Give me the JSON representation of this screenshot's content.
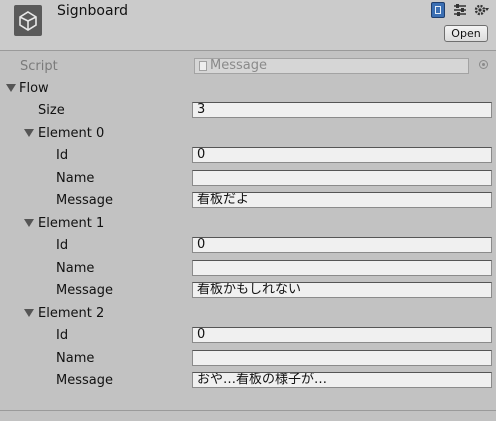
{
  "header": {
    "title": "Signboard",
    "open_label": "Open",
    "icons": [
      "unity-logo-icon",
      "help-book-icon",
      "preset-sliders-icon",
      "gear-icon"
    ]
  },
  "script": {
    "label": "Script",
    "value": "Message"
  },
  "flow": {
    "label": "Flow",
    "size_label": "Size",
    "size_value": "3",
    "elements": [
      {
        "label": "Element 0",
        "id_label": "Id",
        "id": "0",
        "name_label": "Name",
        "name": "",
        "message_label": "Message",
        "message": "看板だよ"
      },
      {
        "label": "Element 1",
        "id_label": "Id",
        "id": "0",
        "name_label": "Name",
        "name": "",
        "message_label": "Message",
        "message": "看板かもしれない"
      },
      {
        "label": "Element 2",
        "id_label": "Id",
        "id": "0",
        "name_label": "Name",
        "name": "",
        "message_label": "Message",
        "message": "おや…看板の様子が…"
      }
    ]
  }
}
